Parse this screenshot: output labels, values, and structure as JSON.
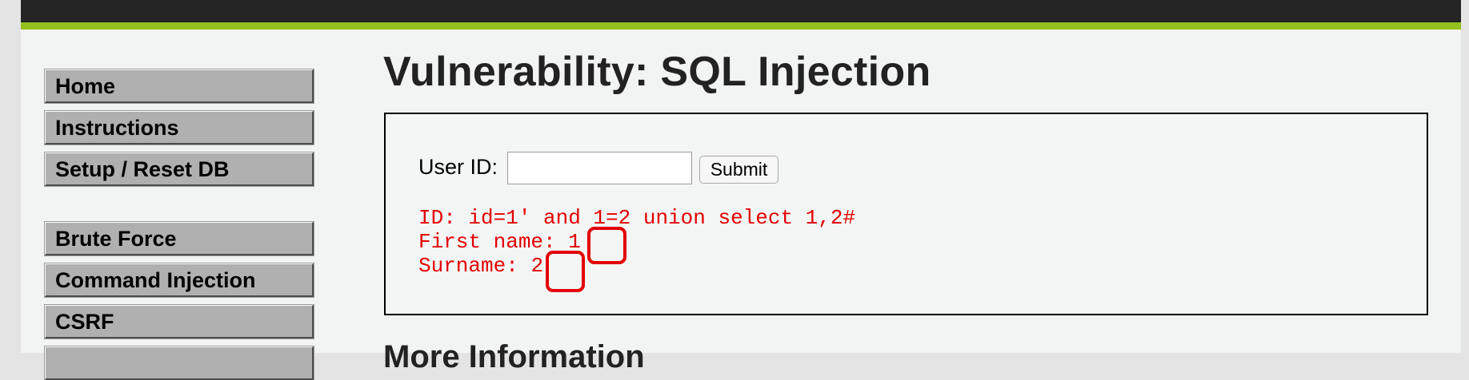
{
  "sidebar": {
    "items": [
      {
        "label": "Home"
      },
      {
        "label": "Instructions"
      },
      {
        "label": "Setup / Reset DB"
      },
      {
        "label": "Brute Force"
      },
      {
        "label": "Command Injection"
      },
      {
        "label": "CSRF"
      }
    ]
  },
  "main": {
    "title": "Vulnerability: SQL Injection",
    "form": {
      "userid_label": "User ID:",
      "userid_value": "",
      "submit_label": "Submit"
    },
    "result": {
      "id_line": "ID: id=1' and 1=2 union select 1,2#",
      "first_name_label": "First name:",
      "first_name_value": "1",
      "surname_label": "Surname:",
      "surname_value": "2"
    },
    "more_info_heading": "More Information"
  },
  "colors": {
    "header": "#242424",
    "accent": "#95c11f",
    "result_text": "#e30000",
    "menu_bg": "#b0b0b0"
  }
}
